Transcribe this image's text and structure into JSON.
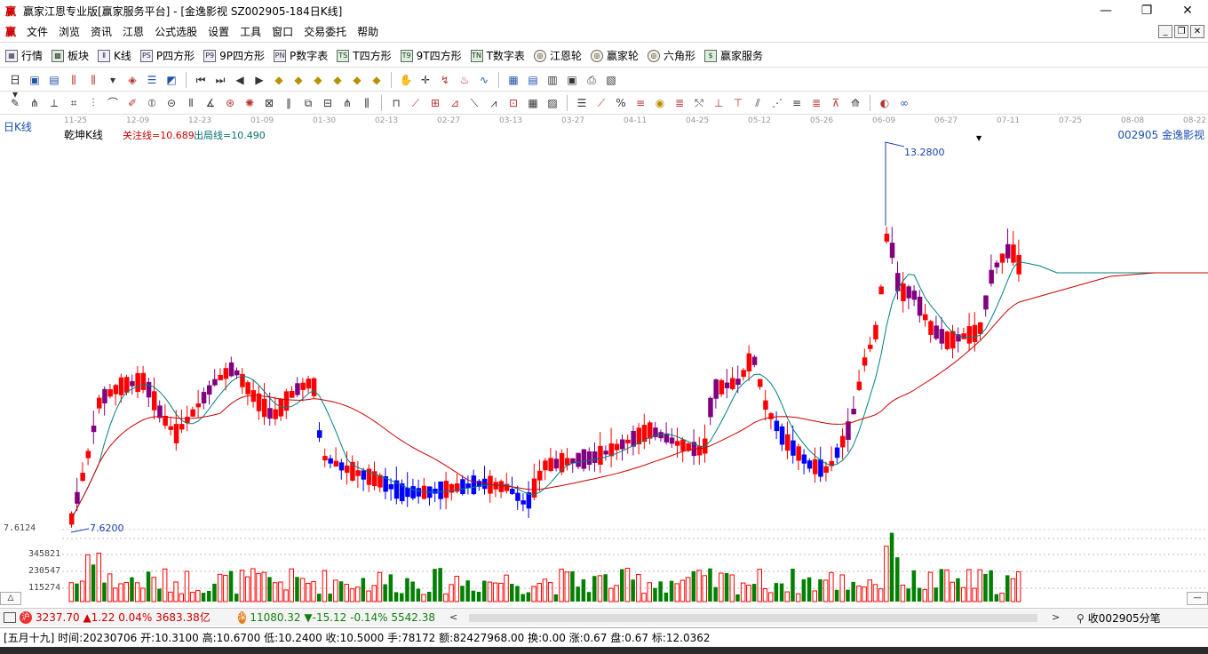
{
  "window": {
    "title": "赢家江恩专业版[赢家服务平台] - [金逸影视  SZ002905-184日K线]",
    "app_logo": "赢",
    "controls": [
      "—",
      "❐",
      "✕"
    ]
  },
  "menu": {
    "items": [
      "文件",
      "浏览",
      "资讯",
      "江恩",
      "公式选股",
      "设置",
      "工具",
      "窗口",
      "交易委托",
      "帮助"
    ],
    "mdi": [
      "_",
      "❐",
      "✕"
    ]
  },
  "toolbar1": {
    "items": [
      {
        "icon": "grid-icon",
        "glyph": "▦",
        "label": "行情"
      },
      {
        "icon": "board-icon",
        "glyph": "▩",
        "label": "板块"
      },
      {
        "icon": "kline-icon",
        "glyph": "Ⅱ",
        "label": "K线"
      },
      {
        "icon": "p4-icon",
        "glyph": "PS",
        "label": "P四方形"
      },
      {
        "icon": "p9-icon",
        "glyph": "P9",
        "label": "9P四方形"
      },
      {
        "icon": "pn-icon",
        "glyph": "PN",
        "label": "P数字表"
      },
      {
        "icon": "ts-icon",
        "glyph": "TS",
        "label": "T四方形"
      },
      {
        "icon": "t9-icon",
        "glyph": "T9",
        "label": "9T四方形"
      },
      {
        "icon": "tn-icon",
        "glyph": "TN",
        "label": "T数字表"
      },
      {
        "icon": "gann-wheel-icon",
        "glyph": "◎",
        "label": "江恩轮"
      },
      {
        "icon": "winner-wheel-icon",
        "glyph": "◎",
        "label": "赢家轮"
      },
      {
        "icon": "hexagon-icon",
        "glyph": "◎",
        "label": "六角形"
      },
      {
        "icon": "dollar-icon",
        "glyph": "$",
        "label": "赢家服务"
      }
    ]
  },
  "chart": {
    "period": "日K线",
    "indicator_name": "乾坤K线",
    "indicator_values": {
      "focus": "关注线=10.689",
      "exit": "出局线=10.490"
    },
    "stock_tag": "002905  金逸影视",
    "dates": [
      "11-25",
      "12-09",
      "12-23",
      "01-09",
      "01-30",
      "02-13",
      "02-27",
      "03-13",
      "03-27",
      "04-11",
      "04-25",
      "05-12",
      "05-26",
      "06-09",
      "06-27",
      "07-11",
      "07-25",
      "08-08",
      "08-22"
    ],
    "max_label": "13.2800",
    "min_label": "7.6200",
    "price_axis_label": "7.6124",
    "volume_ticks": [
      "345821",
      "230547",
      "115274"
    ],
    "colors": {
      "up": "#ff0000",
      "down": "#0000ff",
      "neutral": "#800080",
      "vol_up": "#ff0000",
      "vol_down": "#008000",
      "ma_fast": "#008080",
      "ma_slow": "#cc0000"
    }
  },
  "statusbar": {
    "sh_icon": "沪",
    "sh_index": "3237.70 ▲1.22 0.04% 3683.38亿",
    "sz_icon": "深",
    "sz_index": "11080.32 ▼-15.12 -0.14% 5542.38",
    "scroll_left": "<",
    "scroll_right": ">",
    "receive": "收002905分笔"
  },
  "infobar": {
    "text": "[五月十九] 时间:20230706 开:10.3100 高:10.6700 低:10.2400 收:10.5000 手:78172 额:82427968.00 换:0.00 涨:0.67 盘:0.67 标:12.0362"
  }
}
